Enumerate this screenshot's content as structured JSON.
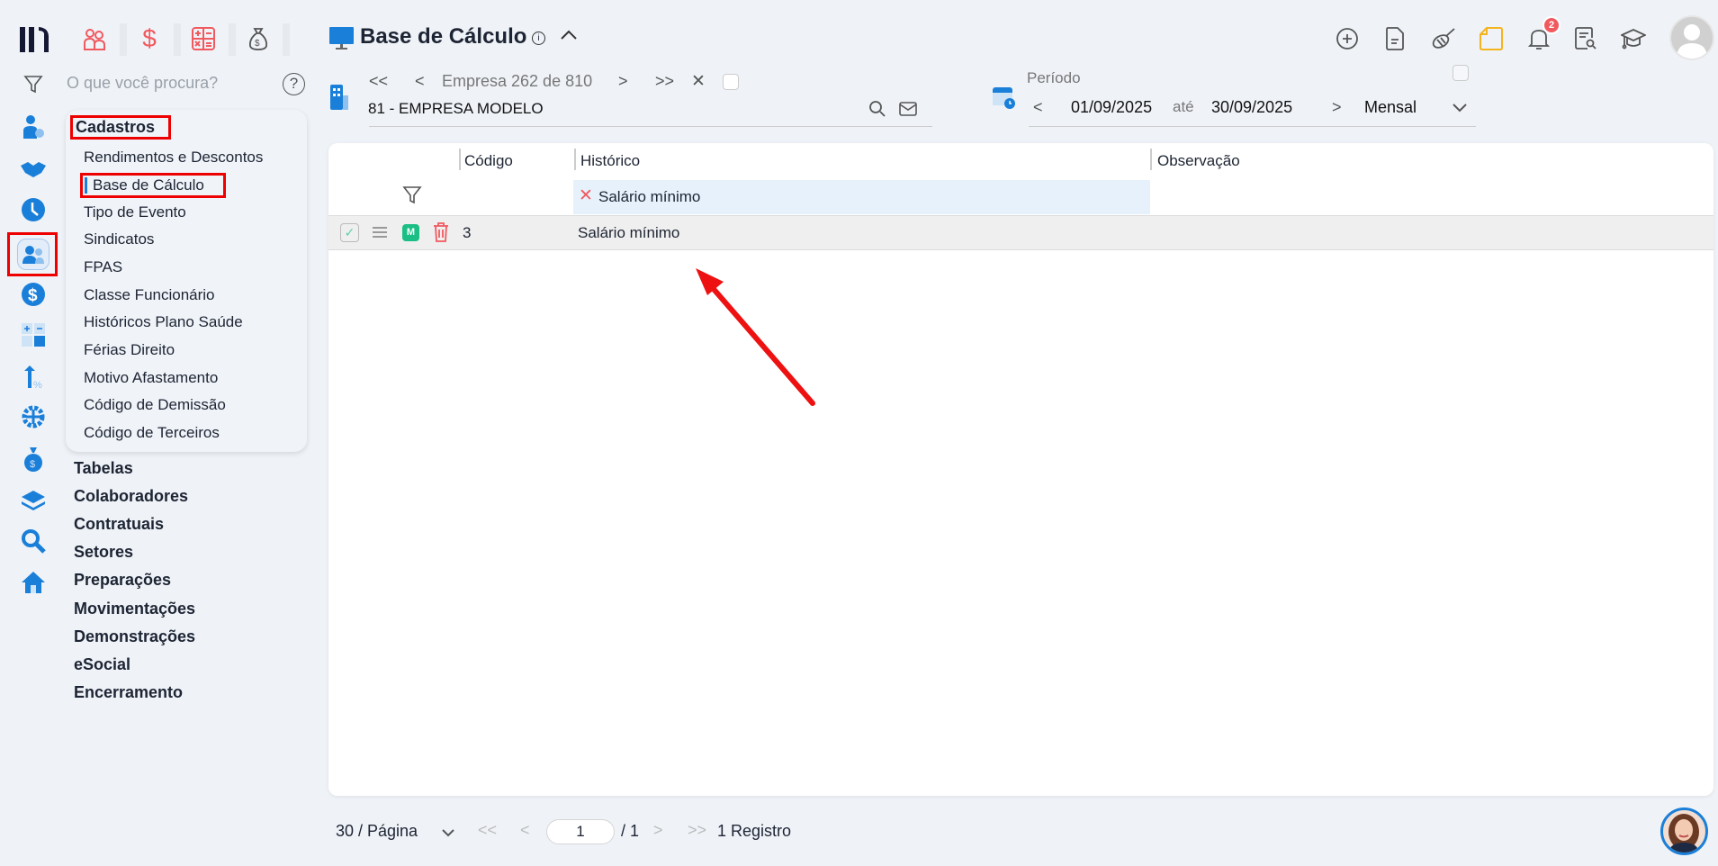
{
  "top_modules": [
    "people-icon",
    "dollar-icon",
    "calculator-icon",
    "money-bag-icon"
  ],
  "search": {
    "placeholder": "O que você procura?"
  },
  "page": {
    "title": "Base de Cálculo"
  },
  "company_nav": {
    "label": "Empresa 262 de 810",
    "company": "81 - EMPRESA MODELO"
  },
  "period": {
    "label": "Período",
    "start": "01/09/2025",
    "sep": "até",
    "end": "30/09/2025",
    "type": "Mensal"
  },
  "notifications": {
    "count": "2"
  },
  "menu": {
    "section": "Cadastros",
    "items": [
      "Rendimentos e Descontos",
      "Base de Cálculo",
      "Tipo de Evento",
      "Sindicatos",
      "FPAS",
      "Classe Funcionário",
      "Históricos Plano Saúde",
      "Férias Direito",
      "Motivo Afastamento",
      "Código de Demissão",
      "Código de Terceiros"
    ],
    "active": "Base de Cálculo",
    "groups": [
      "Tabelas",
      "Colaboradores",
      "Contratuais",
      "Setores",
      "Preparações",
      "Movimentações",
      "Demonstrações",
      "eSocial",
      "Encerramento"
    ]
  },
  "table": {
    "columns": [
      "Código",
      "Histórico",
      "Observação"
    ],
    "filter_historico": "Salário mínimo",
    "rows": [
      {
        "badge": "M",
        "codigo": "3",
        "historico": "Salário mínimo",
        "observacao": ""
      }
    ],
    "colors": {
      "badge": "#1bbf86",
      "delete": "#f0585e",
      "filter_bg": "#e6f1fc"
    }
  },
  "pagination": {
    "page_size": "30 / Página",
    "page": "1",
    "total_pages": "/ 1",
    "records": "1 Registro"
  },
  "colors": {
    "accent": "#1a7fd9",
    "highlight": "#ee0000",
    "arrow": "#ee1111"
  }
}
